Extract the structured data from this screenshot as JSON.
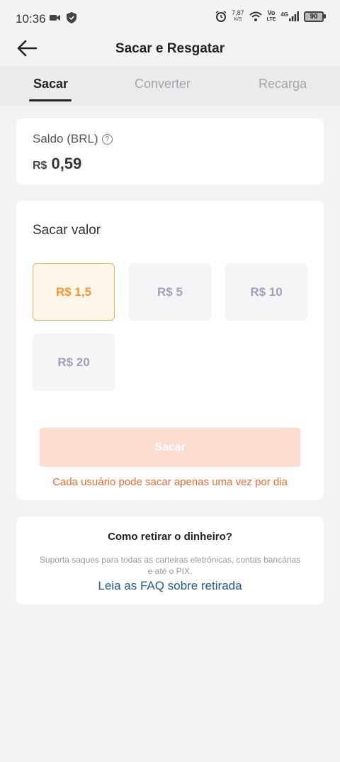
{
  "status_bar": {
    "time": "10:36",
    "speed_value": "7,87",
    "speed_unit": "K/S",
    "volte_top": "Vo",
    "volte_bottom": "LTE",
    "network": "4G",
    "battery": "90"
  },
  "header": {
    "title": "Sacar e Resgatar",
    "back_icon": "arrow-left-icon"
  },
  "tabs": [
    {
      "label": "Sacar",
      "active": true
    },
    {
      "label": "Converter",
      "active": false
    },
    {
      "label": "Recarga",
      "active": false
    }
  ],
  "balance": {
    "label": "Saldo (BRL)",
    "help_symbol": "?",
    "currency": "R$",
    "amount": "0,59"
  },
  "withdraw": {
    "title": "Sacar valor",
    "options": [
      {
        "label": "R$ 1,5",
        "selected": true
      },
      {
        "label": "R$ 5",
        "selected": false
      },
      {
        "label": "R$ 10",
        "selected": false
      },
      {
        "label": "R$ 20",
        "selected": false
      }
    ],
    "submit_label": "Sacar",
    "note": "Cada usuário pode sacar apenas uma vez por dia"
  },
  "faq": {
    "title": "Como retirar o dinheiro?",
    "description": "Suporta saques para todas as carteiras eletrônicas, contas bancárias e até o PIX.",
    "link": "Leia as FAQ sobre retirada"
  },
  "colors": {
    "accent": "#f0962a",
    "submit_disabled": "#fddcd1",
    "note": "#e86b38",
    "link": "#1e5a88"
  }
}
